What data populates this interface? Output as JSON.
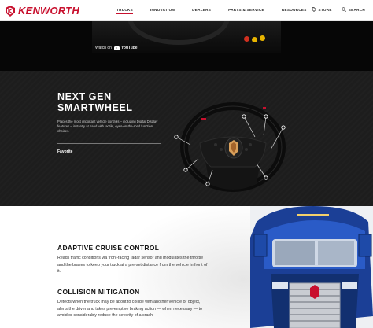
{
  "brand": {
    "name": "KENWORTH",
    "color": "#c8102e"
  },
  "nav": {
    "items": [
      {
        "label": "TRUCKS",
        "active": true
      },
      {
        "label": "INNOVATION",
        "active": false
      },
      {
        "label": "DEALERS",
        "active": false
      },
      {
        "label": "PARTS & SERVICE",
        "active": false
      },
      {
        "label": "RESOURCES",
        "active": false
      }
    ],
    "store_label": "STORE",
    "search_label": "SEARCH"
  },
  "video": {
    "watch_on": "Watch on",
    "platform": "YouTube"
  },
  "smartwheel": {
    "title_line1": "NEXT GEN",
    "title_line2": "SMARTWHEEL",
    "body": "Places the most important vehicle controls – including Digital Display features – instantly at hand with tactile, eyes-on-the-road function choices.",
    "favorite_label": "Favorite"
  },
  "features": [
    {
      "heading": "ADAPTIVE CRUISE CONTROL",
      "body": "Reads traffic conditions via front-facing radar sensor and modulates the throttle and the brakes to keep your truck at a pre-set distance from the vehicle in front of it."
    },
    {
      "heading": "COLLISION MITIGATION",
      "body": "Detects when the truck may be about to collide with another vehicle or object, alerts the driver and takes pre-emptive braking action — when necessary — to avoid or considerably reduce the severity of a crash."
    }
  ],
  "icons": {
    "logo": "kenworth-logo-icon",
    "store": "tag-icon",
    "search": "search-icon",
    "youtube": "youtube-icon"
  }
}
